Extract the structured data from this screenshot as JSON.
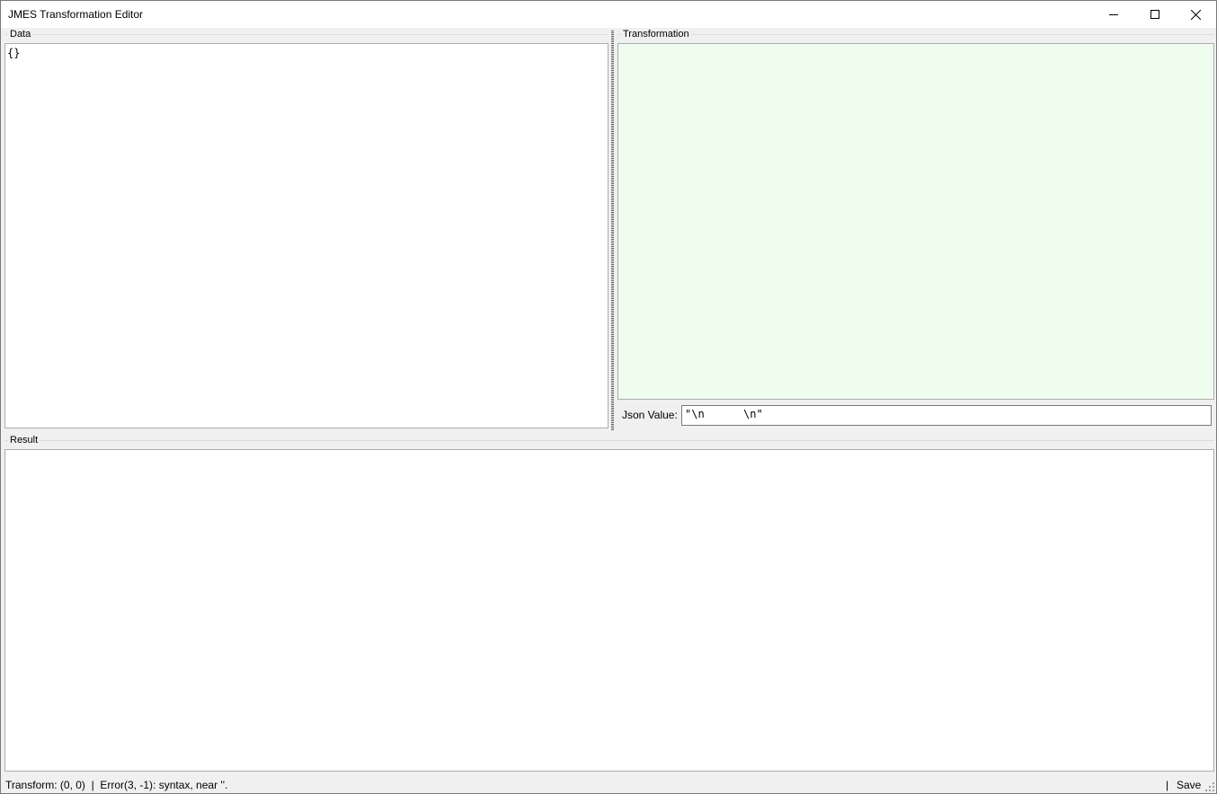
{
  "window": {
    "title": "JMES Transformation Editor"
  },
  "data_panel": {
    "label": "Data",
    "content": "{}"
  },
  "transformation_panel": {
    "label": "Transformation",
    "content": "",
    "json_value_label": "Json Value:",
    "json_value": "\"\\n      \\n\""
  },
  "result_panel": {
    "label": "Result",
    "content": ""
  },
  "status": {
    "text": "Transform: (0, 0)  |  Error(3, -1): syntax, near ''.",
    "separator": "|",
    "save_label": "Save"
  },
  "colors": {
    "transformation_bg": "#effdef",
    "editor_bg": "#ffffff",
    "window_bg": "#f0f0f0"
  },
  "icons": {
    "minimize": "minimize-icon",
    "maximize": "maximize-icon",
    "close": "close-icon",
    "grip": "resize-grip-icon"
  }
}
